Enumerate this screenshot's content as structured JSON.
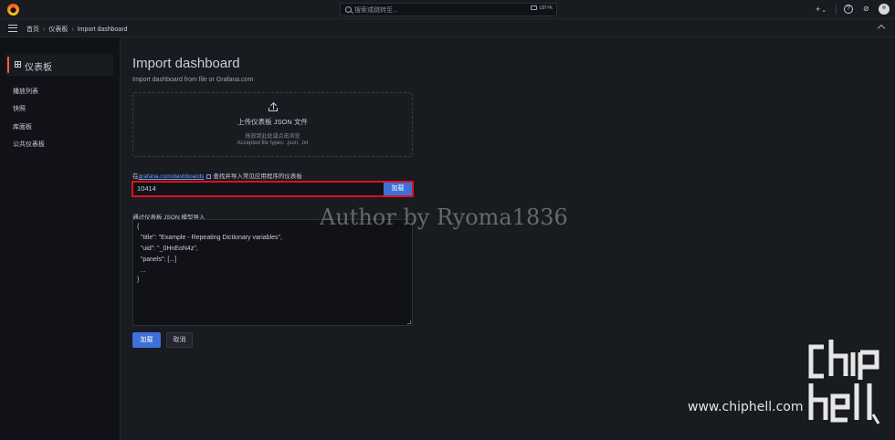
{
  "topbar": {
    "search_placeholder": "搜索或跳转至...",
    "shortcut": "ctrl+k",
    "plus": "+",
    "chevron": "⌄",
    "help": "?",
    "news": "⊘"
  },
  "breadcrumb": {
    "home": "首页",
    "dashboards": "仪表板",
    "current": "Import dashboard"
  },
  "sidebar": {
    "title": "仪表板",
    "items": [
      {
        "label": "播放列表"
      },
      {
        "label": "快照"
      },
      {
        "label": "库面板"
      },
      {
        "label": "公共仪表板"
      }
    ]
  },
  "main": {
    "title": "Import dashboard",
    "subtitle": "Import dashboard from file or Grafana.com",
    "upload": {
      "title": "上传仪表板 JSON 文件",
      "hint": "拖放到此处或点击浏览",
      "types": "Accepted file types: .json, .txt"
    },
    "grafana": {
      "prefix": "在",
      "link": "grafana.com/dashboards",
      "suffix": "查找并导入常见应用程序的仪表板",
      "value": "10414",
      "load": "加载"
    },
    "json": {
      "label": "通过仪表板 JSON 模型导入",
      "lines": [
        "{",
        "  \"title\": \"Example - Repeating Dictionary variables\",",
        "  \"uid\": \"_0HnEoN4z\",",
        "  \"panels\": [...]",
        "  ...",
        "}"
      ]
    },
    "buttons": {
      "load": "加载",
      "cancel": "取消"
    }
  },
  "watermark": {
    "author": "Author by Ryoma1836",
    "site": "www.chiphell.com",
    "logo_text": "chip hell"
  },
  "colors": {
    "accent": "#3d71d9",
    "highlight": "#e0101f",
    "sidebar_marker": "#f55f3e"
  }
}
